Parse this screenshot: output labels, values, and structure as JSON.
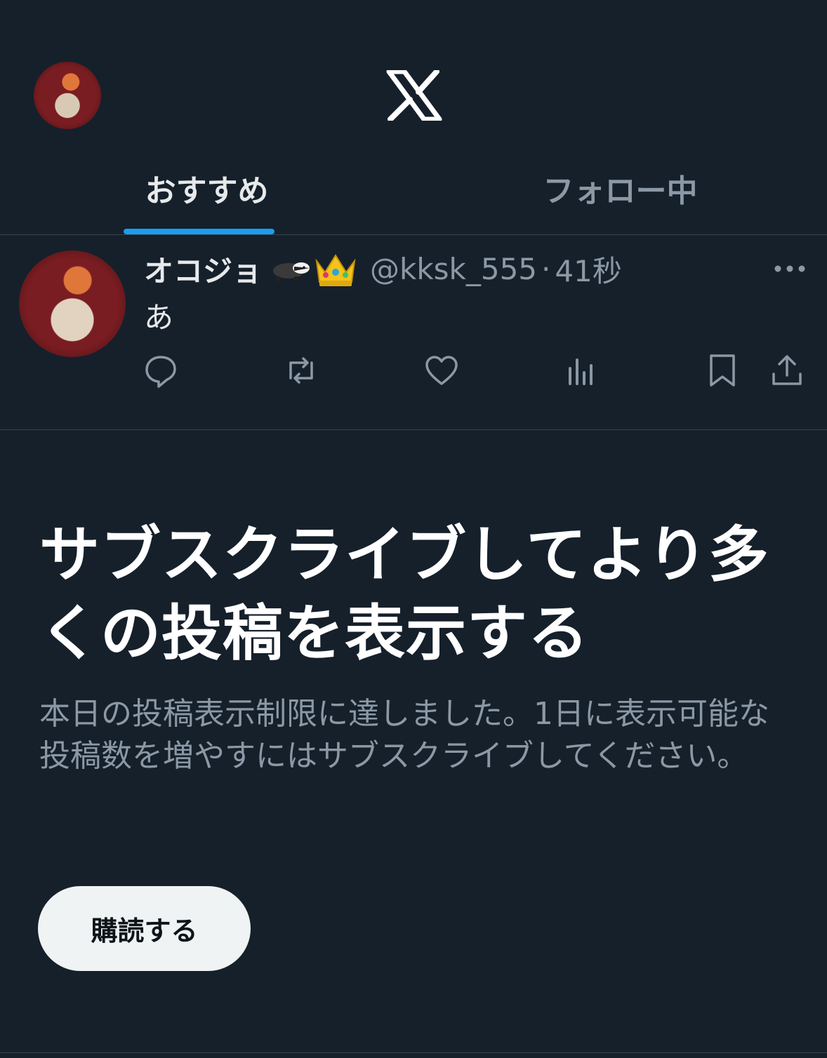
{
  "header": {
    "logo_name": "x-logo"
  },
  "tabs": [
    {
      "label": "おすすめ",
      "active": true
    },
    {
      "label": "フォロー中",
      "active": false
    }
  ],
  "post": {
    "display_name": "オコジョ",
    "handle": "@kksk_555",
    "separator": "·",
    "time": "41秒",
    "text": "あ",
    "actions": [
      "reply-icon",
      "repost-icon",
      "like-icon",
      "views-icon",
      "bookmark-icon",
      "share-icon"
    ]
  },
  "promo": {
    "title": "サブスクライブしてより多くの投稿を表示する",
    "body": "本日の投稿表示制限に達しました。1日に表示可能な投稿数を増やすにはサブスクライブしてください。",
    "button_label": "購読する"
  },
  "colors": {
    "background": "#15202b",
    "accent": "#1d9bf0",
    "muted_text": "#8b98a5",
    "divider": "#38444d",
    "button_bg": "#eff3f4"
  }
}
